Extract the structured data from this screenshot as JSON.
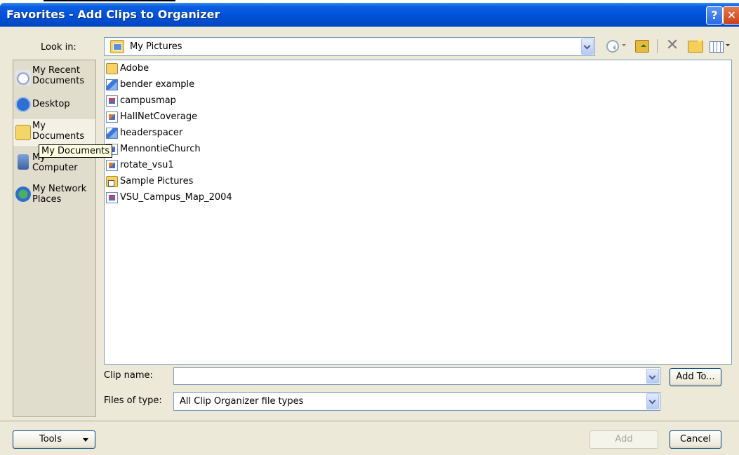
{
  "window": {
    "title": "Favorites - Add Clips to Organizer",
    "help_label": "?",
    "close_label": "✕"
  },
  "toolbar": {
    "lookin_label": "Look in:",
    "lookin_value": "My Pictures",
    "delete_glyph": "✕"
  },
  "places": [
    {
      "label": "My Recent\nDocuments",
      "icon": "recent-documents-icon"
    },
    {
      "label": "Desktop",
      "icon": "desktop-icon"
    },
    {
      "label": "My\nDocuments",
      "icon": "my-documents-icon"
    },
    {
      "label": "My\nComputer",
      "icon": "my-computer-icon"
    },
    {
      "label": "My Network\nPlaces",
      "icon": "network-places-icon"
    }
  ],
  "tooltip": "My Documents",
  "files": [
    {
      "name": "Adobe",
      "icon": "folder-icon"
    },
    {
      "name": "bender example",
      "icon": "drawing-file-icon"
    },
    {
      "name": "campusmap",
      "icon": "image-file-icon"
    },
    {
      "name": "HallNetCoverage",
      "icon": "image-file-icon"
    },
    {
      "name": "headerspacer",
      "icon": "drawing-file-icon"
    },
    {
      "name": "MennontieChurch",
      "icon": "image-file-icon"
    },
    {
      "name": "rotate_vsu1",
      "icon": "image-file-icon"
    },
    {
      "name": "Sample Pictures",
      "icon": "folder-shortcut-icon"
    },
    {
      "name": "VSU_Campus_Map_2004",
      "icon": "image-file-icon"
    }
  ],
  "fields": {
    "clip_name_label": "Clip name:",
    "clip_name_value": "",
    "file_type_label": "Files of type:",
    "file_type_value": "All Clip Organizer file types"
  },
  "buttons": {
    "add_to": "Add To...",
    "add": "Add",
    "cancel": "Cancel",
    "tools": "Tools"
  }
}
